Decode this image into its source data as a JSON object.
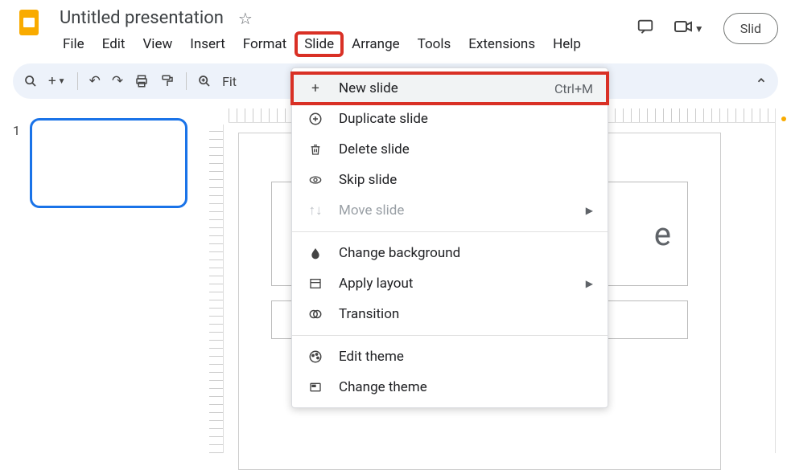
{
  "header": {
    "title": "Untitled presentation",
    "menus": [
      "File",
      "Edit",
      "View",
      "Insert",
      "Format",
      "Slide",
      "Arrange",
      "Tools",
      "Extensions",
      "Help"
    ],
    "slideshow_label": "Slid"
  },
  "toolbar": {
    "fit_label": "Fit"
  },
  "slides": {
    "thumb_number": "1"
  },
  "canvas": {
    "title_placeholder": "e"
  },
  "sidemenu": {
    "new_slide": "New slide",
    "new_slide_shortcut": "Ctrl+M",
    "duplicate": "Duplicate slide",
    "delete": "Delete slide",
    "skip": "Skip slide",
    "move": "Move slide",
    "change_bg": "Change background",
    "apply_layout": "Apply layout",
    "transition": "Transition",
    "edit_theme": "Edit theme",
    "change_theme": "Change theme"
  }
}
